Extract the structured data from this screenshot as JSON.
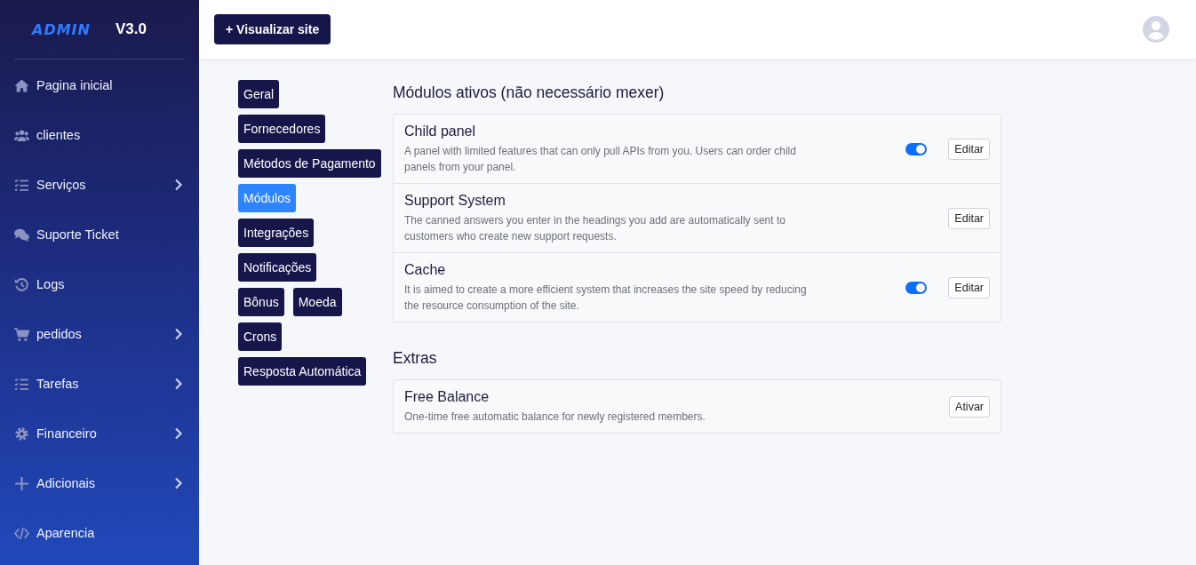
{
  "brand": {
    "logo": "ADMIN",
    "version": "V3.0"
  },
  "header": {
    "button": "+ Visualizar site"
  },
  "sidebar": {
    "items": [
      {
        "label": "Pagina inicial",
        "expandable": false
      },
      {
        "label": "clientes",
        "expandable": false
      },
      {
        "label": "Serviços",
        "expandable": true
      },
      {
        "label": "Suporte Ticket",
        "expandable": false
      },
      {
        "label": "Logs",
        "expandable": false
      },
      {
        "label": "pedidos",
        "expandable": true
      },
      {
        "label": "Tarefas",
        "expandable": true
      },
      {
        "label": "Financeiro",
        "expandable": true
      },
      {
        "label": "Adicionais",
        "expandable": true
      },
      {
        "label": "Aparencia",
        "expandable": false
      }
    ]
  },
  "tab_rows": [
    [
      {
        "label": "Geral",
        "selected": false
      }
    ],
    [
      {
        "label": "Fornecedores",
        "selected": false
      }
    ],
    [
      {
        "label": "Métodos de Pagamento",
        "selected": false
      }
    ],
    [
      {
        "label": "Módulos",
        "selected": true
      }
    ],
    [
      {
        "label": "Integrações",
        "selected": false
      }
    ],
    [
      {
        "label": "Notificações",
        "selected": false
      }
    ],
    [
      {
        "label": "Bônus",
        "selected": false
      },
      {
        "label": "Moeda",
        "selected": false
      }
    ],
    [
      {
        "label": "Crons",
        "selected": false
      }
    ],
    [
      {
        "label": "Resposta Automática",
        "selected": false
      }
    ]
  ],
  "sections": [
    {
      "title": "Módulos ativos (não necessário mexer)",
      "modules": [
        {
          "name": "Child panel",
          "description": "A panel with limited features that can only pull APIs from you. Users can order child panels from your panel.",
          "kind": "toggle",
          "on": true,
          "button": "Editar"
        },
        {
          "name": "Support System",
          "description": "The canned answers you enter in the headings you add are automatically sent to customers who create new support requests.",
          "kind": "plain",
          "button": "Editar"
        },
        {
          "name": "Cache",
          "description": "It is aimed to create a more efficient system that increases the site speed by reducing the resource consumption of the site.",
          "kind": "toggle",
          "on": true,
          "button": "Editar"
        }
      ]
    },
    {
      "title": "Extras",
      "modules": [
        {
          "name": "Free Balance",
          "description": "One-time free automatic balance for newly registered members.",
          "kind": "plain",
          "button": "Ativar"
        }
      ]
    }
  ]
}
